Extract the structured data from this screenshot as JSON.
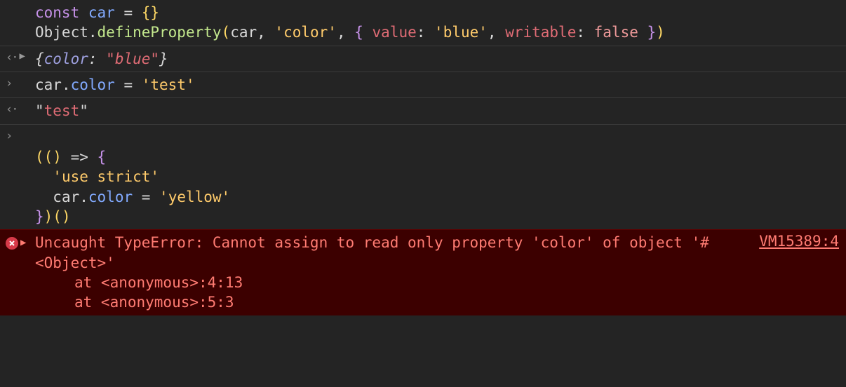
{
  "entries": [
    {
      "kind": "input",
      "code": {
        "line1": {
          "kw_const": "const",
          "name": "car",
          "eq": " = ",
          "braces": "{}"
        },
        "line2": {
          "obj": "Object",
          "dot1": ".",
          "method": "defineProperty",
          "open": "(",
          "arg1": "car",
          "comma1": ", ",
          "str1": "'color'",
          "comma2": ", ",
          "braceOpen": "{ ",
          "k1": "value",
          "colon1": ": ",
          "v1": "'blue'",
          "comma3": ", ",
          "k2": "writable",
          "colon2": ": ",
          "v2": "false",
          "braceClose": " }",
          "close": ")"
        }
      }
    },
    {
      "kind": "output_object",
      "preview": {
        "open": "{",
        "k": "color",
        "colon": ": ",
        "v": "\"blue\"",
        "close": "}"
      }
    },
    {
      "kind": "input",
      "code_simple": {
        "obj": "car",
        "dot": ".",
        "prop": "color",
        "eq": " = ",
        "str": "'test'"
      }
    },
    {
      "kind": "output_string",
      "value": "\"test\""
    },
    {
      "kind": "input_multiline",
      "code": {
        "empty": "",
        "l1_arrowOpen": "(()",
        "l1_arrow": " => ",
        "l1_brace": "{",
        "l2_str": "'use strict'",
        "l3_obj": "car",
        "l3_dot": ".",
        "l3_prop": "color",
        "l3_eq": " = ",
        "l3_str": "'yellow'",
        "l4_brace": "}",
        "l4_close": ")()"
      }
    },
    {
      "kind": "error",
      "message": "Uncaught TypeError: Cannot assign to read only property 'color' of object '#<Object>'",
      "stack": [
        "at <anonymous>:4:13",
        "at <anonymous>:5:3"
      ],
      "source": "VM15389:4"
    }
  ]
}
